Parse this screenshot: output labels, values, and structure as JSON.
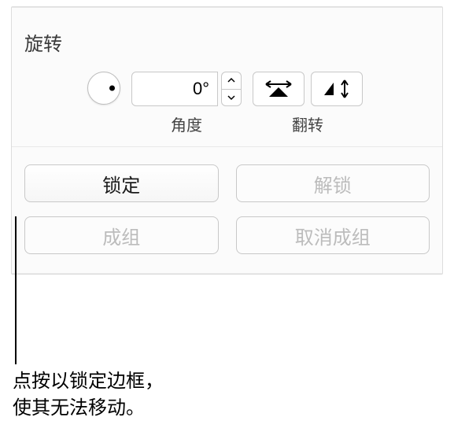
{
  "rotation": {
    "section_title": "旋转",
    "angle_value": "0°",
    "angle_label": "角度",
    "flip_label": "翻转"
  },
  "buttons": {
    "lock": "锁定",
    "unlock": "解锁",
    "group": "成组",
    "ungroup": "取消成组"
  },
  "callout": {
    "line1": "点按以锁定边框，",
    "line2": "使其无法移动。"
  }
}
